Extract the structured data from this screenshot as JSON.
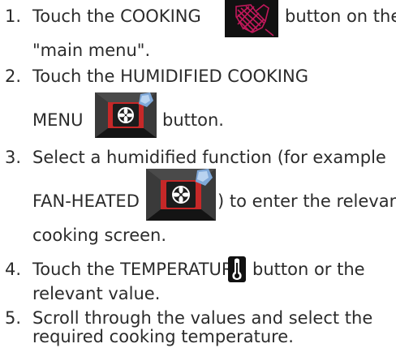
{
  "steps": [
    {
      "number": "1.",
      "line1_before": "Touch the COOKING",
      "line1_after": "button on the",
      "line2": "\"main menu\".",
      "icon": "oven-mitt-cooking-icon"
    },
    {
      "number": "2.",
      "line1": "Touch the HUMIDIFIED COOKING",
      "line2_before": "MENU",
      "line2_after": "button.",
      "icon": "humidified-fan-icon"
    },
    {
      "number": "3.",
      "line1": "Select a humidified function (for example",
      "line2_before": "FAN-HEATED",
      "line2_after": ") to enter the relevant",
      "line3": "cooking screen.",
      "icon": "fan-heated-humidified-icon"
    },
    {
      "number": "4.",
      "line1_before": "Touch the TEMPERATURE",
      "line1_after": "button or the",
      "line2": "relevant value.",
      "icon": "thermometer-icon"
    },
    {
      "number": "5.",
      "line1": "Scroll through the values and select the",
      "line2": "required cooking temperature."
    }
  ]
}
